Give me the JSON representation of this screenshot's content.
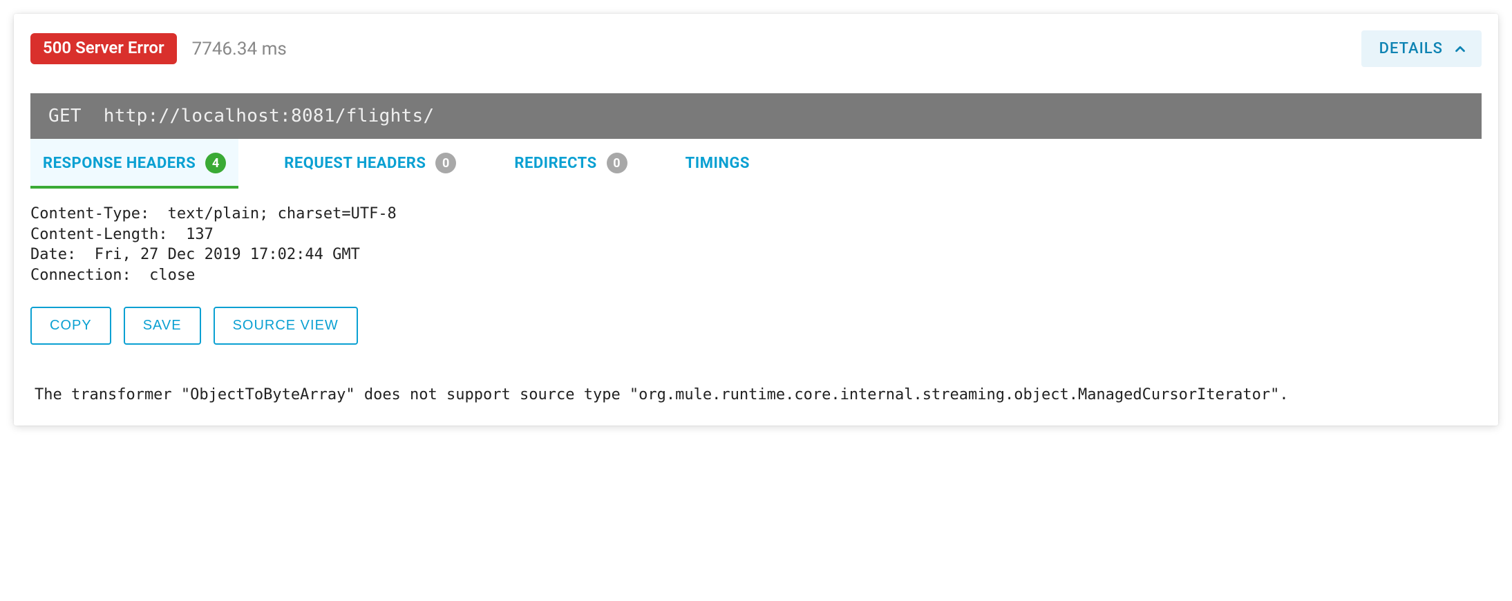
{
  "status": {
    "label": "500 Server Error",
    "time": "7746.34 ms"
  },
  "details_button": {
    "label": "DETAILS"
  },
  "request": {
    "method": "GET",
    "url": "http://localhost:8081/flights/"
  },
  "tabs": {
    "response_headers": {
      "label": "RESPONSE HEADERS",
      "count": "4"
    },
    "request_headers": {
      "label": "REQUEST HEADERS",
      "count": "0"
    },
    "redirects": {
      "label": "REDIRECTS",
      "count": "0"
    },
    "timings": {
      "label": "TIMINGS"
    }
  },
  "response_headers": [
    {
      "name": "Content-Type",
      "value": "text/plain; charset=UTF-8"
    },
    {
      "name": "Content-Length",
      "value": "137"
    },
    {
      "name": "Date",
      "value": "Fri, 27 Dec 2019 17:02:44 GMT"
    },
    {
      "name": "Connection",
      "value": "close"
    }
  ],
  "headers_text": "Content-Type:  text/plain; charset=UTF-8\nContent-Length:  137\nDate:  Fri, 27 Dec 2019 17:02:44 GMT\nConnection:  close",
  "buttons": {
    "copy": "COPY",
    "save": "SAVE",
    "source_view": "SOURCE VIEW"
  },
  "response_body": "The transformer \"ObjectToByteArray\" does not support source type \"org.mule.runtime.core.internal.streaming.object.ManagedCursorIterator\".",
  "colors": {
    "error": "#d9302c",
    "accent": "#0aa0d2",
    "active_underline": "#3aaa35",
    "details_bg": "#e8f4fa"
  }
}
